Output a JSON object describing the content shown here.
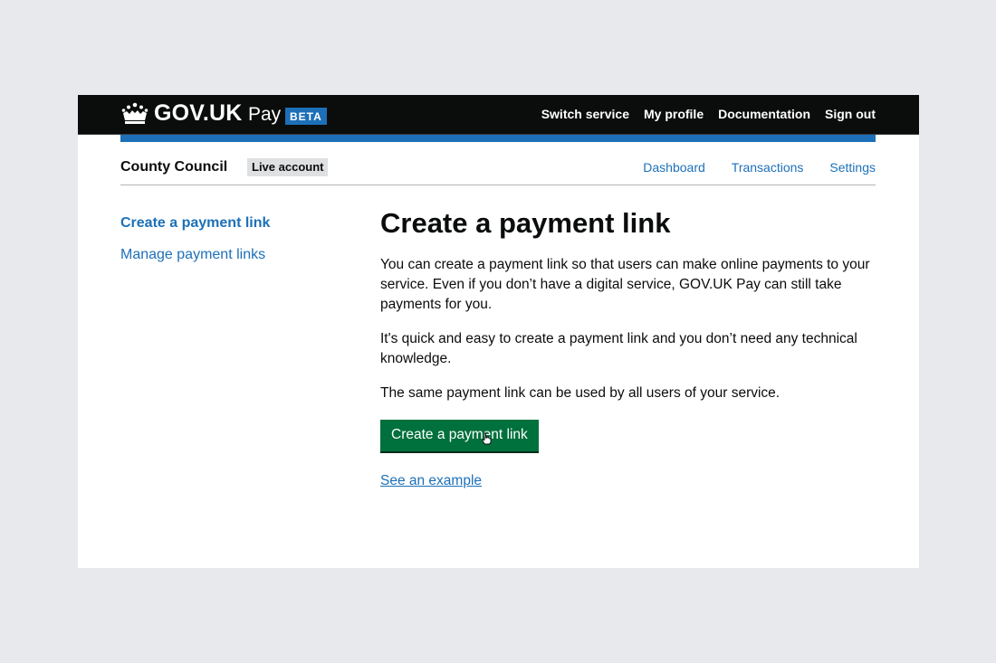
{
  "header": {
    "logo_text": "GOV.UK",
    "product_name": "Pay",
    "phase_tag": "BETA",
    "nav": [
      "Switch service",
      "My profile",
      "Documentation",
      "Sign out"
    ]
  },
  "service": {
    "name": "County Council",
    "account_tag": "Live account",
    "nav": [
      "Dashboard",
      "Transactions",
      "Settings"
    ]
  },
  "sidebar": {
    "items": [
      {
        "label": "Create a payment link",
        "active": true
      },
      {
        "label": "Manage payment links",
        "active": false
      }
    ]
  },
  "main": {
    "heading": "Create a payment link",
    "paragraphs": [
      "You can create a payment link so that users can make online payments to your service. Even if you don’t have a digital service, GOV.UK Pay can still take payments for you.",
      "It's quick and easy to create a payment link and you don’t need any technical knowledge.",
      "The same payment link can be used by all users of your service."
    ],
    "button_label": "Create a payment link",
    "example_link": "See an example"
  },
  "icons": {
    "logo": "crown-icon",
    "pointer": "hand-cursor-icon"
  },
  "colors": {
    "header_bg": "#0b0c0c",
    "brand_blue": "#1d70b8",
    "button_green": "#00703c",
    "page_bg": "#e8e9ed"
  }
}
